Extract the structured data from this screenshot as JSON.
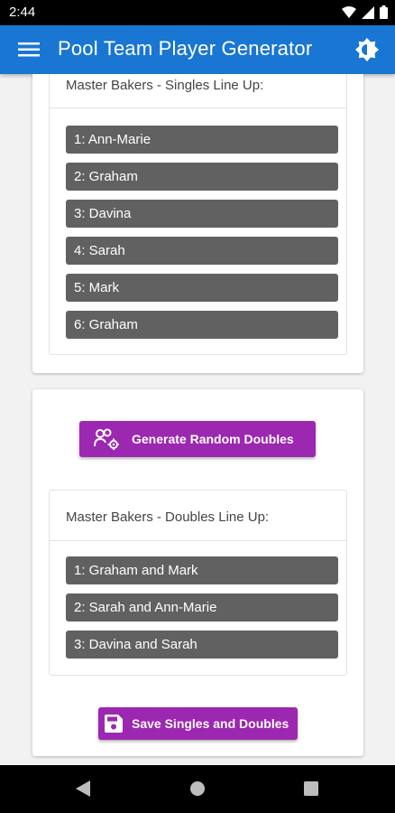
{
  "status_bar": {
    "time": "2:44"
  },
  "app_bar": {
    "title": "Pool Team Player Generator"
  },
  "singles": {
    "header": "Master Bakers - Singles Line Up:",
    "players": [
      "1: Ann-Marie",
      "2: Graham",
      "3: Davina",
      "4: Sarah",
      "5: Mark",
      "6: Graham"
    ]
  },
  "doubles": {
    "button_label": "Generate Random Doubles",
    "header": "Master Bakers - Doubles Line Up:",
    "pairs": [
      "1: Graham and Mark",
      "2: Sarah and Ann-Marie",
      "3: Davina and Sarah"
    ]
  },
  "save_button_label": "Save Singles and Doubles",
  "colors": {
    "app_bar": "#1976d2",
    "accent": "#9c27b0",
    "row": "#616161"
  },
  "icons": [
    "menu-icon",
    "theme-toggle-icon",
    "wifi-icon",
    "signal-icon",
    "battery-icon",
    "group-settings-icon",
    "save-icon",
    "back-icon",
    "home-icon",
    "recents-icon"
  ]
}
